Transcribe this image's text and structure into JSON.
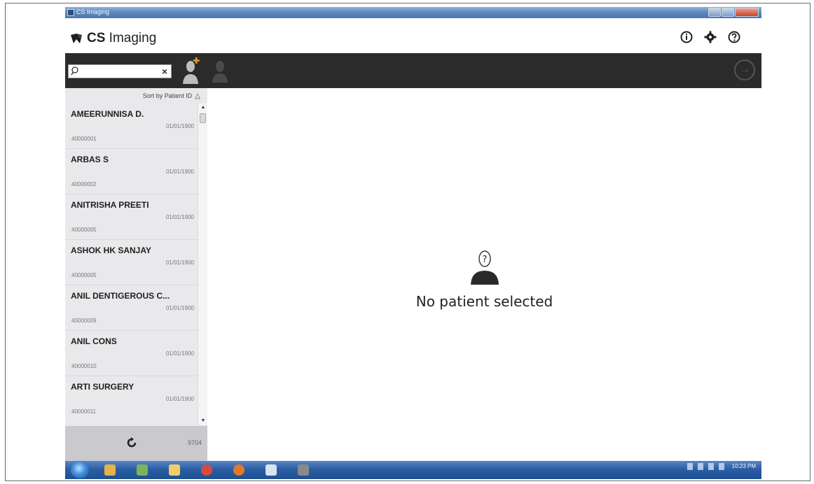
{
  "window": {
    "title": "CS Imaging"
  },
  "app": {
    "logo_brand": "CS",
    "logo_name": " Imaging"
  },
  "header_icons": [
    "info-icon",
    "gear-icon",
    "help-icon"
  ],
  "search": {
    "placeholder": "",
    "value": ""
  },
  "sort": {
    "label": "Sort by Patient ID",
    "direction": "ascending"
  },
  "patients": [
    {
      "name": "AMEERUNNISA D.",
      "dob": "01/01/1900",
      "id": "40000001"
    },
    {
      "name": "ARBAS S",
      "dob": "01/01/1900",
      "id": "40000002"
    },
    {
      "name": "ANITRISHA PREETI",
      "dob": "01/01/1900",
      "id": "40000005"
    },
    {
      "name": "ASHOK HK SANJAY",
      "dob": "01/01/1900",
      "id": "40000005"
    },
    {
      "name": "ANIL DENTIGEROUS C...",
      "dob": "01/01/1900",
      "id": "40000009"
    },
    {
      "name": "ANIL CONS",
      "dob": "01/01/1900",
      "id": "40000010"
    },
    {
      "name": "ARTI SURGERY",
      "dob": "01/01/1900",
      "id": "40000011"
    }
  ],
  "footer": {
    "patient_count": "9704"
  },
  "main": {
    "empty_message": "No patient selected"
  },
  "taskbar": {
    "time": "10:23 PM"
  },
  "colors": {
    "toolbar_dark": "#2b2b2b",
    "sidebar_bg": "#e9e9ec",
    "accent_gold": "#e0a21a"
  }
}
